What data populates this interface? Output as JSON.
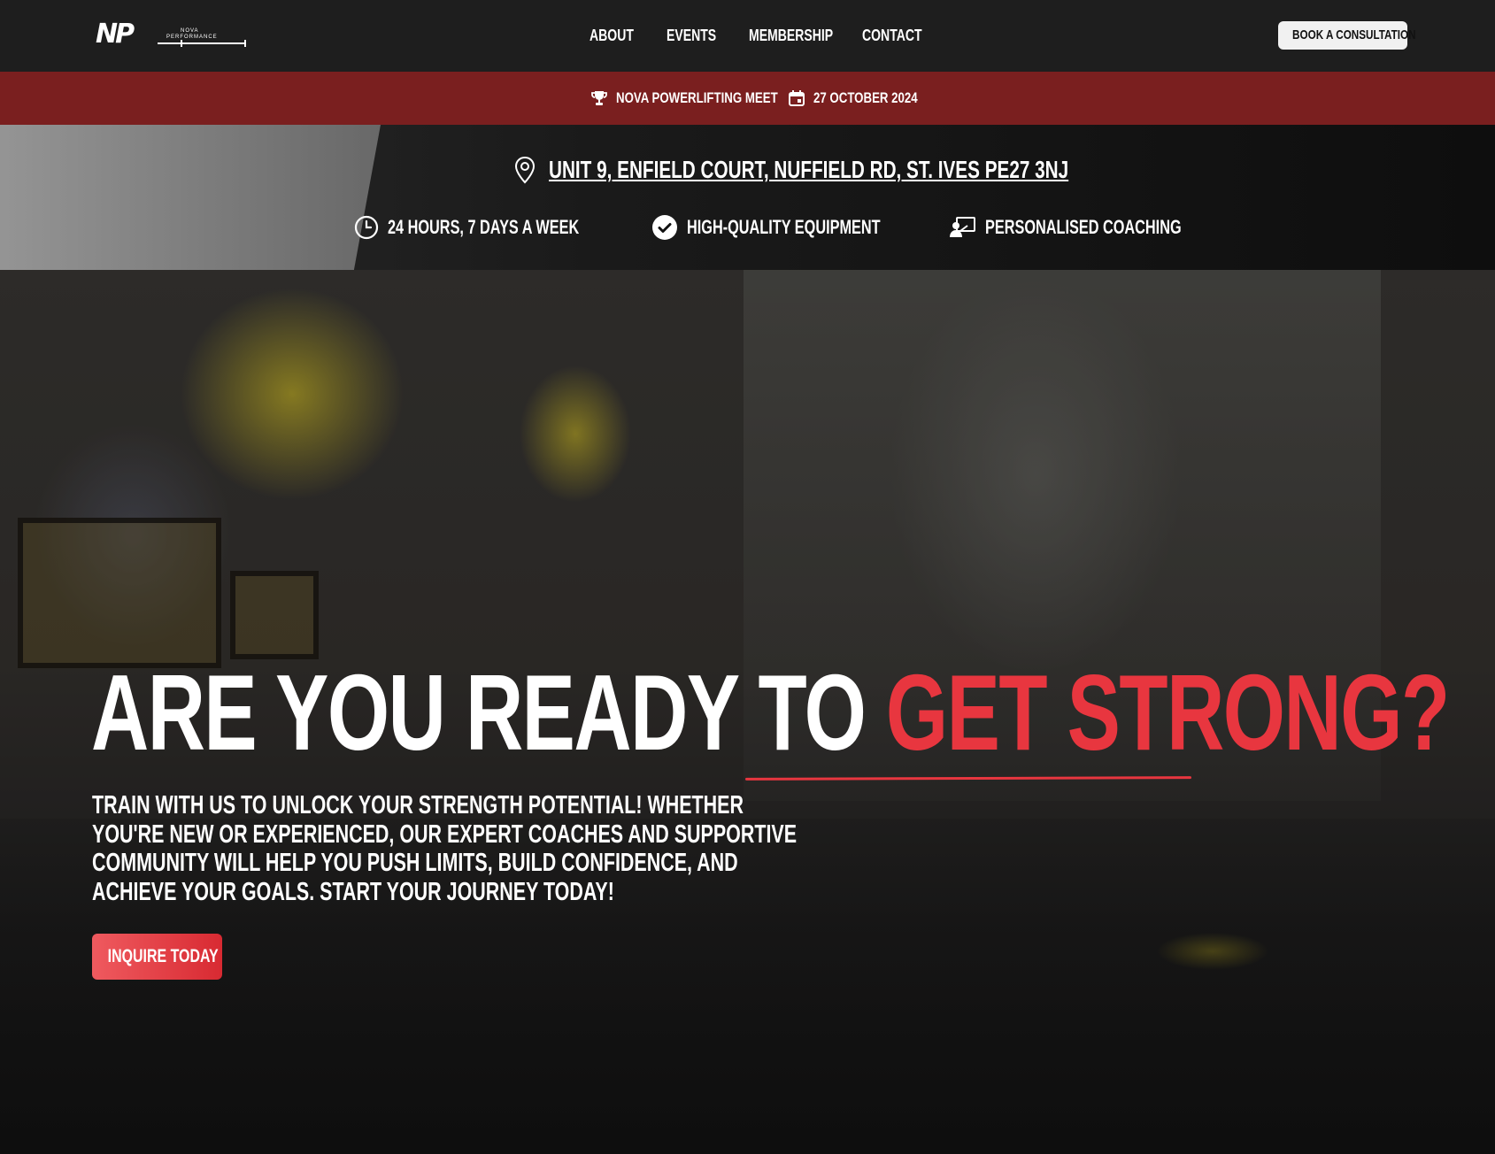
{
  "nav": {
    "logo_mark": "NP",
    "logo_line1": "NOVA",
    "logo_line2": "PERFORMANCE",
    "links": [
      "ABOUT",
      "EVENTS",
      "MEMBERSHIP",
      "CONTACT"
    ],
    "cta_label": "BOOK A CONSULTATION"
  },
  "event_banner": {
    "meet_icon": "trophy-icon",
    "meet_label": "NOVA POWERLIFTING MEET",
    "date_icon": "calendar-icon",
    "date_label": "27 OCTOBER 2024",
    "background_color": "#7a1f1f"
  },
  "info": {
    "address_icon": "location-pin-icon",
    "address": "UNIT 9, ENFIELD COURT, NUFFIELD RD, ST. IVES PE27 3NJ",
    "features": [
      {
        "icon": "clock-icon",
        "label": "24 HOURS, 7 DAYS A WEEK"
      },
      {
        "icon": "check-circle-icon",
        "label": "HIGH-QUALITY EQUIPMENT"
      },
      {
        "icon": "coaching-icon",
        "label": "PERSONALISED COACHING"
      }
    ]
  },
  "hero": {
    "headline_white": "ARE YOU READY TO ",
    "headline_red": "GET STRONG?",
    "subtext": "TRAIN WITH US TO UNLOCK YOUR STRENGTH POTENTIAL! WHETHER YOU'RE NEW OR EXPERIENCED, OUR EXPERT COACHES AND SUPPORTIVE COMMUNITY WILL HELP YOU PUSH LIMITS, BUILD CONFIDENCE, AND ACHIEVE YOUR GOALS. START YOUR JOURNEY TODAY!",
    "cta_label": "INQUIRE TODAY",
    "accent_color": "#e8363f"
  }
}
